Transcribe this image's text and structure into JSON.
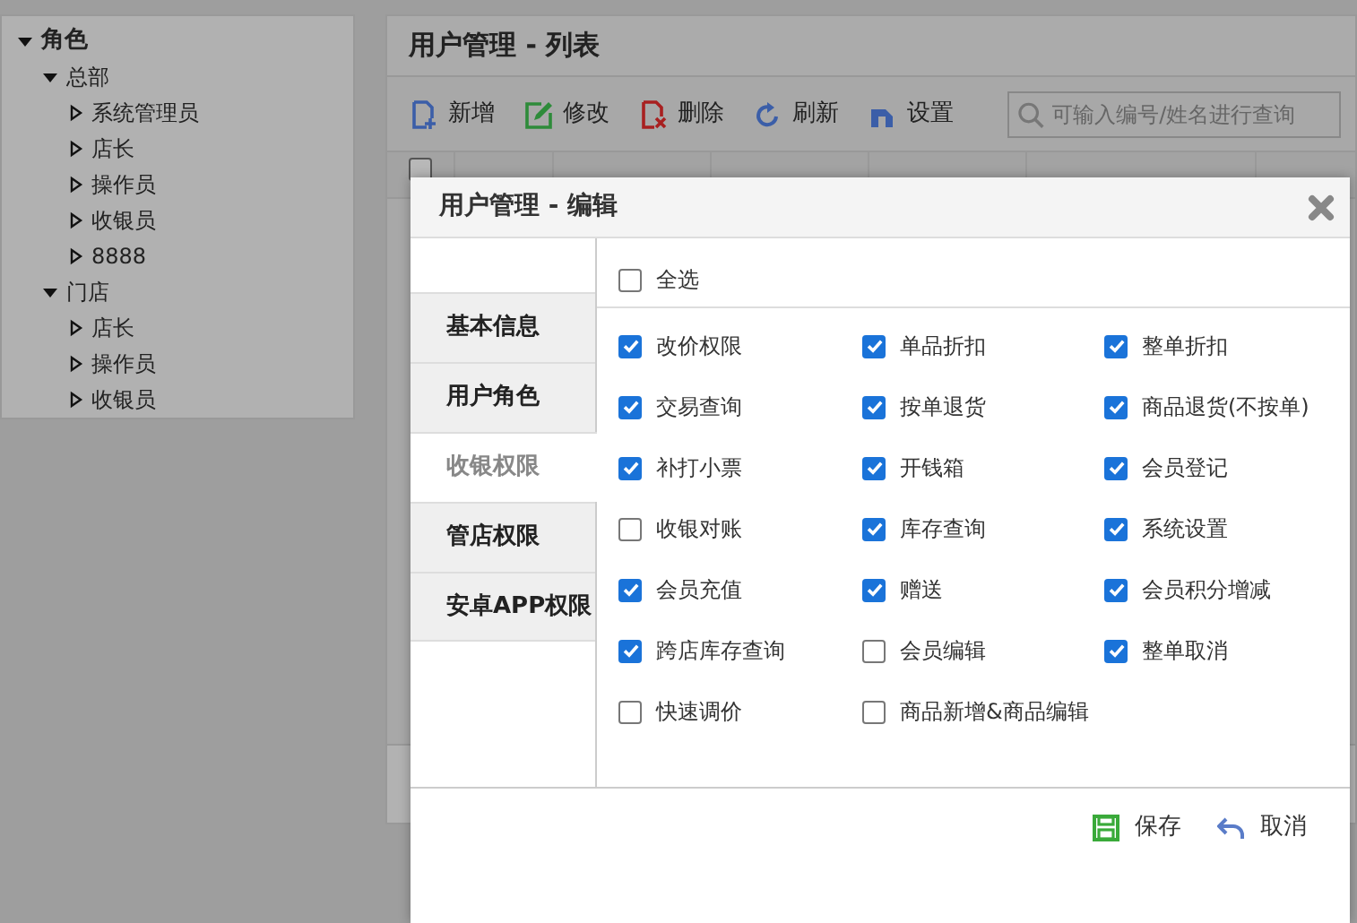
{
  "tree": {
    "label": "角色",
    "expanded": true,
    "children": [
      {
        "label": "总部",
        "expanded": true,
        "children": [
          {
            "label": "系统管理员",
            "expanded": false
          },
          {
            "label": "店长",
            "expanded": false
          },
          {
            "label": "操作员",
            "expanded": false
          },
          {
            "label": "收银员",
            "expanded": false
          },
          {
            "label": "8888",
            "expanded": false
          }
        ]
      },
      {
        "label": "门店",
        "expanded": true,
        "children": [
          {
            "label": "店长",
            "expanded": false
          },
          {
            "label": "操作员",
            "expanded": false
          },
          {
            "label": "收银员",
            "expanded": false
          }
        ]
      }
    ]
  },
  "list_panel": {
    "title": "用户管理 - 列表",
    "toolbar": [
      {
        "kind": "add",
        "label": "新增"
      },
      {
        "kind": "edit",
        "label": "修改"
      },
      {
        "kind": "delete",
        "label": "删除"
      },
      {
        "kind": "refresh",
        "label": "刷新"
      },
      {
        "kind": "settings",
        "label": "设置"
      }
    ],
    "search": {
      "placeholder": "可输入编号/姓名进行查询"
    },
    "table": {
      "header_checkbox": {
        "checked": false
      }
    }
  },
  "dialog": {
    "title": "用户管理 - 编辑",
    "tabs": [
      {
        "label": "基本信息",
        "selected": false
      },
      {
        "label": "用户角色",
        "selected": false
      },
      {
        "label": "收银权限",
        "selected": true
      },
      {
        "label": "管店权限",
        "selected": false
      },
      {
        "label": "安卓APP权限",
        "selected": false
      }
    ],
    "select_all": {
      "label": "全选",
      "checked": false
    },
    "permissions": [
      {
        "label": "改价权限",
        "checked": true
      },
      {
        "label": "单品折扣",
        "checked": true
      },
      {
        "label": "整单折扣",
        "checked": true
      },
      {
        "label": "交易查询",
        "checked": true
      },
      {
        "label": "按单退货",
        "checked": true
      },
      {
        "label": "商品退货(不按单)",
        "checked": true
      },
      {
        "label": "补打小票",
        "checked": true
      },
      {
        "label": "开钱箱",
        "checked": true
      },
      {
        "label": "会员登记",
        "checked": true
      },
      {
        "label": "收银对账",
        "checked": false
      },
      {
        "label": "库存查询",
        "checked": true
      },
      {
        "label": "系统设置",
        "checked": true
      },
      {
        "label": "会员充值",
        "checked": true
      },
      {
        "label": "赠送",
        "checked": true
      },
      {
        "label": "会员积分增减",
        "checked": true
      },
      {
        "label": "跨店库存查询",
        "checked": true
      },
      {
        "label": "会员编辑",
        "checked": false
      },
      {
        "label": "整单取消",
        "checked": true
      },
      {
        "label": "快速调价",
        "checked": false
      },
      {
        "label": "商品新增&商品编辑",
        "checked": false
      }
    ],
    "buttons": [
      {
        "kind": "save",
        "label": "保存"
      },
      {
        "kind": "cancel",
        "label": "取消"
      }
    ]
  }
}
